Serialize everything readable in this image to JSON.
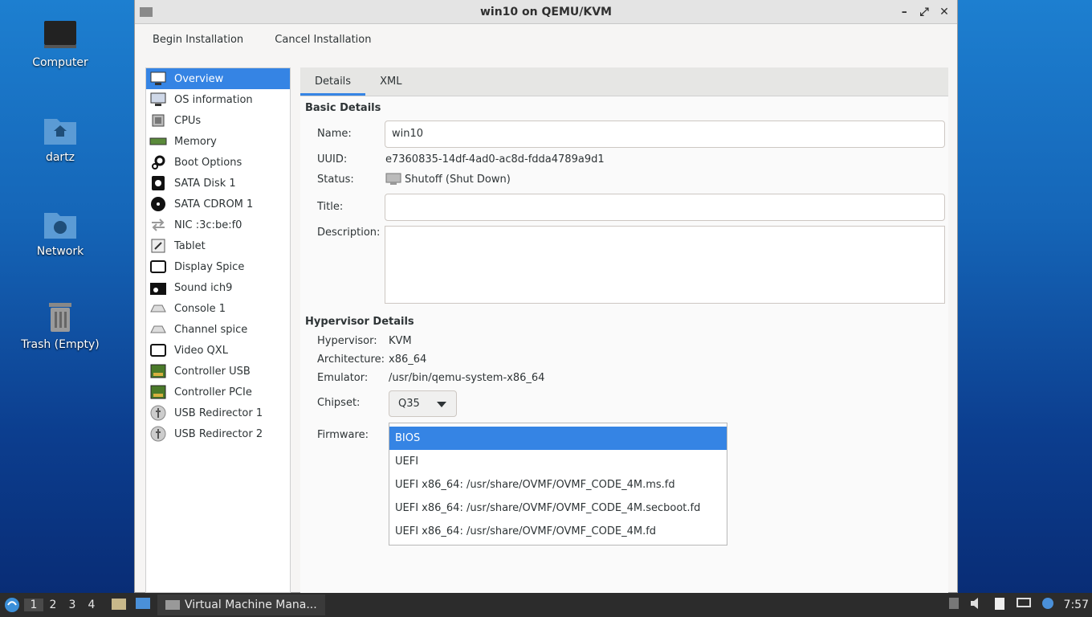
{
  "desktop": {
    "icons": [
      {
        "label": "Computer"
      },
      {
        "label": "dartz"
      },
      {
        "label": "Network"
      },
      {
        "label": "Trash (Empty)"
      }
    ]
  },
  "window": {
    "title": "win10 on QEMU/KVM",
    "controls": [
      "–",
      "⤢",
      "✕"
    ]
  },
  "toolbar": {
    "begin": "Begin Installation",
    "cancel": "Cancel Installation"
  },
  "sidebar": {
    "items": [
      {
        "label": "Overview",
        "icon": "monitor-icon"
      },
      {
        "label": "OS information",
        "icon": "computer-icon"
      },
      {
        "label": "CPUs",
        "icon": "cpu-icon"
      },
      {
        "label": "Memory",
        "icon": "memory-icon"
      },
      {
        "label": "Boot Options",
        "icon": "gears-icon"
      },
      {
        "label": "SATA Disk 1",
        "icon": "disk-icon"
      },
      {
        "label": "SATA CDROM 1",
        "icon": "cdrom-icon"
      },
      {
        "label": "NIC :3c:be:f0",
        "icon": "network-arrows-icon"
      },
      {
        "label": "Tablet",
        "icon": "tablet-icon"
      },
      {
        "label": "Display Spice",
        "icon": "display-icon"
      },
      {
        "label": "Sound ich9",
        "icon": "sound-icon"
      },
      {
        "label": "Console 1",
        "icon": "console-icon"
      },
      {
        "label": "Channel spice",
        "icon": "channel-icon"
      },
      {
        "label": "Video QXL",
        "icon": "video-icon"
      },
      {
        "label": "Controller USB",
        "icon": "controller-icon"
      },
      {
        "label": "Controller PCIe",
        "icon": "controller-icon"
      },
      {
        "label": "USB Redirector 1",
        "icon": "usb-icon"
      },
      {
        "label": "USB Redirector 2",
        "icon": "usb-icon"
      }
    ]
  },
  "tabs": {
    "details": "Details",
    "xml": "XML"
  },
  "basic": {
    "heading": "Basic Details",
    "name_label": "Name:",
    "name_value": "win10",
    "uuid_label": "UUID:",
    "uuid_value": "e7360835-14df-4ad0-ac8d-fdda4789a9d1",
    "status_label": "Status:",
    "status_value": "Shutoff (Shut Down)",
    "title_label": "Title:",
    "title_value": "",
    "desc_label": "Description:",
    "desc_value": ""
  },
  "hypervisor": {
    "heading": "Hypervisor Details",
    "hypervisor_label": "Hypervisor:",
    "hypervisor_value": "KVM",
    "arch_label": "Architecture:",
    "arch_value": "x86_64",
    "emulator_label": "Emulator:",
    "emulator_value": "/usr/bin/qemu-system-x86_64",
    "chipset_label": "Chipset:",
    "chipset_value": "Q35",
    "firmware_label": "Firmware:",
    "firmware_options": [
      "BIOS",
      "UEFI",
      "UEFI x86_64: /usr/share/OVMF/OVMF_CODE_4M.ms.fd",
      "UEFI x86_64: /usr/share/OVMF/OVMF_CODE_4M.secboot.fd",
      "UEFI x86_64: /usr/share/OVMF/OVMF_CODE_4M.fd"
    ],
    "firmware_selected": "BIOS"
  },
  "taskbar": {
    "workspaces": [
      "1",
      "2",
      "3",
      "4"
    ],
    "active_workspace": "1",
    "task_label": "Virtual Machine Mana...",
    "clock": "7:57"
  },
  "colors": {
    "accent": "#3584e4",
    "taskbar": "#2c2c2c"
  }
}
